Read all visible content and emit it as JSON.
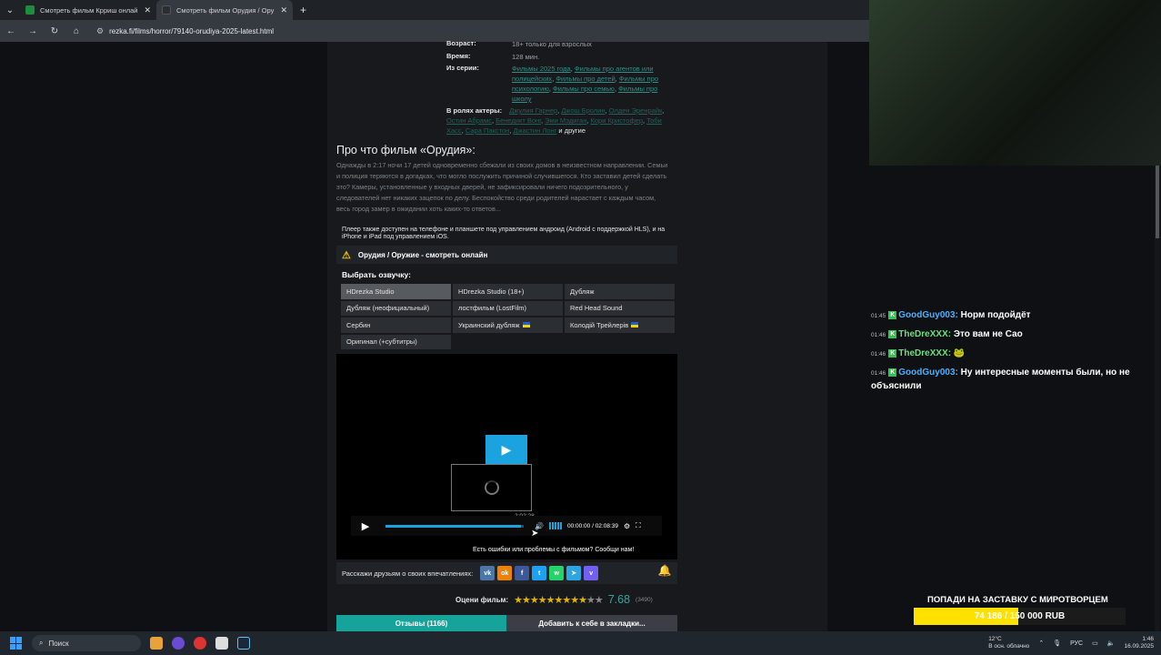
{
  "browser": {
    "tabs": [
      {
        "title": "Смотреть фильм Крриш онлай",
        "active": false
      },
      {
        "title": "Смотреть фильм Орудия / Ору",
        "active": true
      }
    ],
    "url": "rezka.fi/films/horror/79140-orudiya-2025-latest.html"
  },
  "film_info": {
    "age": {
      "label": "Возраст:",
      "value": "18+ только для взрослых"
    },
    "time": {
      "label": "Время:",
      "value": "128 мин."
    },
    "series": {
      "label": "Из серии:",
      "links": [
        "Фильмы 2025 года",
        "Фильмы про агентов или полицейских",
        "Фильмы про детей",
        "Фильмы про психологию",
        "Фильмы про семью",
        "Фильмы про школу"
      ]
    },
    "actors": {
      "label": "В ролях актеры:",
      "names": [
        "Джулия Гарнер",
        "Джош Бролин",
        "Олден Эренрайк",
        "Остин Абрамс",
        "Бенедикт Вонг",
        "Эми Мэдиган",
        "Кори Кристофер",
        "Тоби Хасс",
        "Сара Пакстон",
        "Джастин Лонг"
      ],
      "tail": "и другие"
    }
  },
  "about": {
    "title": "Про что фильм «Орудия»:",
    "text": "Однажды в 2:17 ночи 17 детей одновременно сбежали из своих домов в неизвестном направлении. Семьи и полиция теряются в догадках, что могло послужить причиной случившегося. Кто заставил детей сделать это? Камеры, установленные у входных дверей, не зафиксировали ничего подозрительного, у следователей нет никаких зацепок по делу. Беспокойство среди родителей нарастает с каждым часом, весь город замер в ожидании хоть каких-то ответов..."
  },
  "player": {
    "note": "Плеер также доступен на телефоне и планшете под управлением андроид (Android с поддержкой HLS), и на iPhone и iPad под управлением iOS.",
    "heading": "Орудия / Оружие - смотреть онлайн",
    "voice_title": "Выбрать озвучку:",
    "voices": [
      {
        "label": "HDrezka Studio",
        "selected": true,
        "flag": false
      },
      {
        "label": "HDrezka Studio (18+)",
        "selected": false,
        "flag": false
      },
      {
        "label": "Дубляж",
        "selected": false,
        "flag": false
      },
      {
        "label": "Дубляж (неофициальный)",
        "selected": false,
        "flag": false
      },
      {
        "label": "лостфильм (LostFilm)",
        "selected": false,
        "flag": false
      },
      {
        "label": "Red Head Sound",
        "selected": false,
        "flag": false
      },
      {
        "label": "Сербин",
        "selected": false,
        "flag": false
      },
      {
        "label": "Украинский дубляж",
        "selected": false,
        "flag": true
      },
      {
        "label": "Колодій Трейлерів",
        "selected": false,
        "flag": true
      },
      {
        "label": "Оригинал (+субтитры)",
        "selected": false,
        "flag": false
      }
    ],
    "hover_time": "2:02:28",
    "timer": "00:00:00 / 02:08:39",
    "progress": 0.98,
    "errors_text": "Есть ошибки или проблемы с фильмом? Сообщи нам!"
  },
  "share": {
    "text": "Расскажи друзьям о своих впечатлениях:",
    "networks": [
      {
        "name": "vk-icon",
        "glyph": "vk",
        "color": "#4a76a8"
      },
      {
        "name": "ok-icon",
        "glyph": "ok",
        "color": "#ee8208"
      },
      {
        "name": "facebook-icon",
        "glyph": "f",
        "color": "#3b5998"
      },
      {
        "name": "twitter-icon",
        "glyph": "t",
        "color": "#1da1f2"
      },
      {
        "name": "whatsapp-icon",
        "glyph": "w",
        "color": "#25d366"
      },
      {
        "name": "telegram-icon",
        "glyph": "➤",
        "color": "#2ca5e0"
      },
      {
        "name": "viber-icon",
        "glyph": "v",
        "color": "#7360f2"
      }
    ]
  },
  "rating": {
    "label": "Оцени фильм:",
    "stars_filled": 9,
    "stars_total": 11,
    "score": "7.68",
    "votes": "(3490)"
  },
  "buttons": {
    "reviews": "Отзывы (1166)",
    "bookmark": "Добавить к себе в закладки..."
  },
  "chat": [
    {
      "time": "01:45",
      "nick": "GoodGuy003:",
      "text": "Норм подойдёт",
      "nick_color": "blue"
    },
    {
      "time": "01:46",
      "nick": "TheDreXXX:",
      "text": "Это вам не Сао",
      "nick_color": "green"
    },
    {
      "time": "01:46",
      "nick": "TheDreXXX:",
      "text": "🐸",
      "nick_color": "green"
    },
    {
      "time": "01:46",
      "nick": "GoodGuy003:",
      "text": "Ну интересные моменты были, но не объяснили",
      "nick_color": "blue"
    }
  ],
  "goal": {
    "title": "ПОПАДИ НА ЗАСТАВКУ С МИРОТВОРЦЕМ",
    "text": "74 186 / 150 000 RUB",
    "fraction": 0.4946
  },
  "taskbar": {
    "search": "Поиск",
    "weather_temp": "12°C",
    "weather_desc": "В осн. облачно",
    "lang": "РУС",
    "time": "1:46",
    "date": "16.09.2025"
  }
}
